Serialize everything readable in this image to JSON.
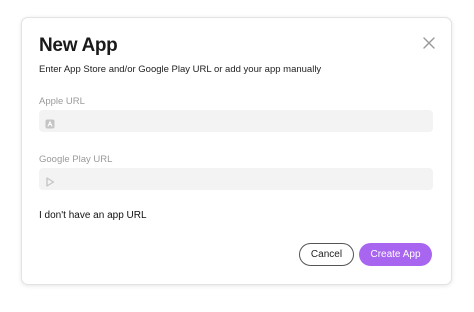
{
  "dialog": {
    "title": "New App",
    "subtitle": "Enter App Store and/or Google Play URL or add your app manually",
    "close_icon": "close-icon"
  },
  "fields": {
    "apple": {
      "label": "Apple URL",
      "value": "",
      "placeholder": "",
      "icon": "apple-store-icon"
    },
    "google": {
      "label": "Google Play URL",
      "value": "",
      "placeholder": "",
      "icon": "google-play-icon"
    }
  },
  "links": {
    "no_url": "I don't have an app URL"
  },
  "buttons": {
    "cancel": "Cancel",
    "create": "Create App"
  },
  "colors": {
    "accent": "#a866f0",
    "field_bg": "#f3f3f3",
    "muted_label": "#9a9a9a"
  }
}
